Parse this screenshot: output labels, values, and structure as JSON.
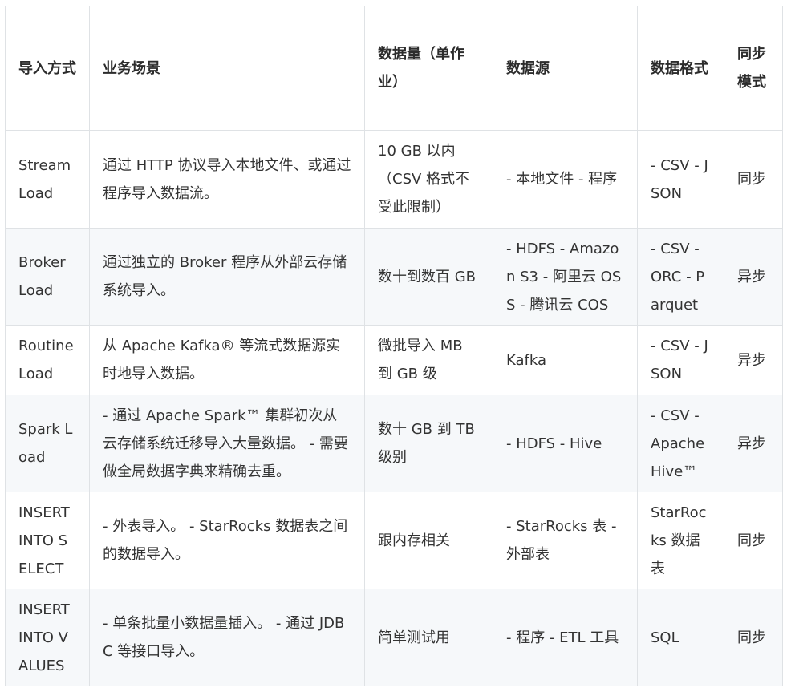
{
  "table": {
    "headers": [
      "导入方式",
      "业务场景",
      "数据量（单作业）",
      "数据源",
      "数据格式",
      "同步模式"
    ],
    "rows": [
      [
        "Stream Load",
        "通过 HTTP 协议导入本地文件、或通过程序导入数据流。",
        "10 GB 以内（CSV 格式不受此限制）",
        "- 本地文件 - 程序",
        "- CSV - JSON",
        "同步"
      ],
      [
        "Broker Load",
        "通过独立的 Broker 程序从外部云存储系统导入。",
        "数十到数百 GB",
        "- HDFS - Amazon S3 - 阿里云 OSS - 腾讯云 COS",
        "- CSV - ORC - Parquet",
        "异步"
      ],
      [
        "Routine Load",
        "从 Apache Kafka® 等流式数据源实时地导入数据。",
        "微批导入 MB 到 GB 级",
        "Kafka",
        "- CSV - JSON",
        "异步"
      ],
      [
        "Spark Load",
        "- 通过 Apache Spark™ 集群初次从云存储系统迁移导入大量数据。 - 需要做全局数据字典来精确去重。",
        "数十 GB 到 TB 级别",
        "- HDFS - Hive",
        "- CSV - Apache Hive™",
        "异步"
      ],
      [
        "INSERT INTO SELECT",
        "- 外表导入。 - StarRocks 数据表之间的数据导入。",
        "跟内存相关",
        "- StarRocks 表 - 外部表",
        "StarRocks 数据表",
        "同步"
      ],
      [
        "INSERT INTO VALUES",
        "- 单条批量小数据量插入。 - 通过 JDBC 等接口导入。",
        "简单测试用",
        "- 程序 - ETL 工具",
        "SQL",
        "同步"
      ]
    ]
  },
  "colors": {
    "border": "#dfe2e5",
    "alt_row_bg": "#f6f8fa",
    "text": "#333333"
  }
}
